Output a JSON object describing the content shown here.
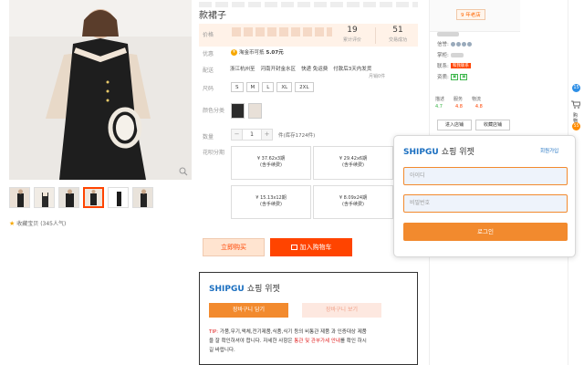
{
  "product": {
    "title_tail": "款裙子",
    "favorite_count_text": "收藏宝贝 (345人气)"
  },
  "price_box": {
    "label": "价格",
    "stats": [
      {
        "value": "19",
        "label": "累计评价"
      },
      {
        "value": "51",
        "label": "交易成功"
      }
    ]
  },
  "rows": {
    "promo_label": "优惠",
    "coupon_text": "淘金币可抵",
    "coupon_amount": "5.07元",
    "ship_label": "配送",
    "ship_from": "浙江杭州至",
    "ship_to": "河南开封金水区",
    "ship_method": "快递 免运费",
    "ship_pay": "付款后3天内发货",
    "ship_note": "月销0件",
    "size_label": "尺码",
    "sizes": [
      "S",
      "M",
      "L",
      "XL",
      "2XL"
    ],
    "color_label": "颜色分类",
    "qty_label": "数量",
    "qty_value": "1",
    "qty_unit": "件(库存1724件)",
    "installment_label": "花呗分期",
    "plans": [
      {
        "amount": "¥ 37.62x3期",
        "fee": "(含手续费)"
      },
      {
        "amount": "¥ 29.42x6期",
        "fee": "(含手续费)"
      },
      {
        "amount": "¥ 15.13x12期",
        "fee": "(含手续费)"
      },
      {
        "amount": "¥ 8.09x24期",
        "fee": "(含手续费)"
      }
    ]
  },
  "buttons": {
    "buy_now": "立即购买",
    "add_cart": "加入购物车"
  },
  "shipgu_widget": {
    "brand": "SHIPGU",
    "title_rest": "쇼핑 위젯",
    "btn_cart_add": "장바구니 담기",
    "btn_cart_view": "장바구니 보기",
    "tip_label": "TIP:",
    "tip_text_1": "가품,무기,액체,전기제품,식품,식기 등의 비통관 제품 과 인증대상 제품",
    "tip_text_2": "을 잘 확인하셔야 합니다. 자세한 사항은",
    "tip_highlight": "통관 및 관부가세 안내",
    "tip_text_3": "를 확인 하시",
    "tip_text_4": "길 바랍니다."
  },
  "shop": {
    "years_badge": "9 年老店",
    "rows": [
      "信誉:",
      "掌柜:",
      "联系:",
      "资质:"
    ],
    "contact_tag": "和我联系",
    "scores_headers": [
      "描述",
      "服务",
      "物流"
    ],
    "scores_values": [
      "4.7",
      "4.8",
      "4.8"
    ],
    "btn_enter": "进入店铺",
    "btn_fav": "收藏店铺"
  },
  "sidebar": {
    "badge_count": "15",
    "cart_text": "购物车",
    "dot_text": "55"
  },
  "popup": {
    "brand": "SHIPGU",
    "title_rest": "쇼핑 위젯",
    "signup": "회원가입",
    "id_placeholder": "아이디",
    "pw_placeholder": "비밀번호",
    "login": "로그인"
  },
  "colors": {
    "accent_orange": "#ff4400",
    "shipgu_blue": "#1b6fc0",
    "shipgu_orange": "#f28a2e"
  }
}
